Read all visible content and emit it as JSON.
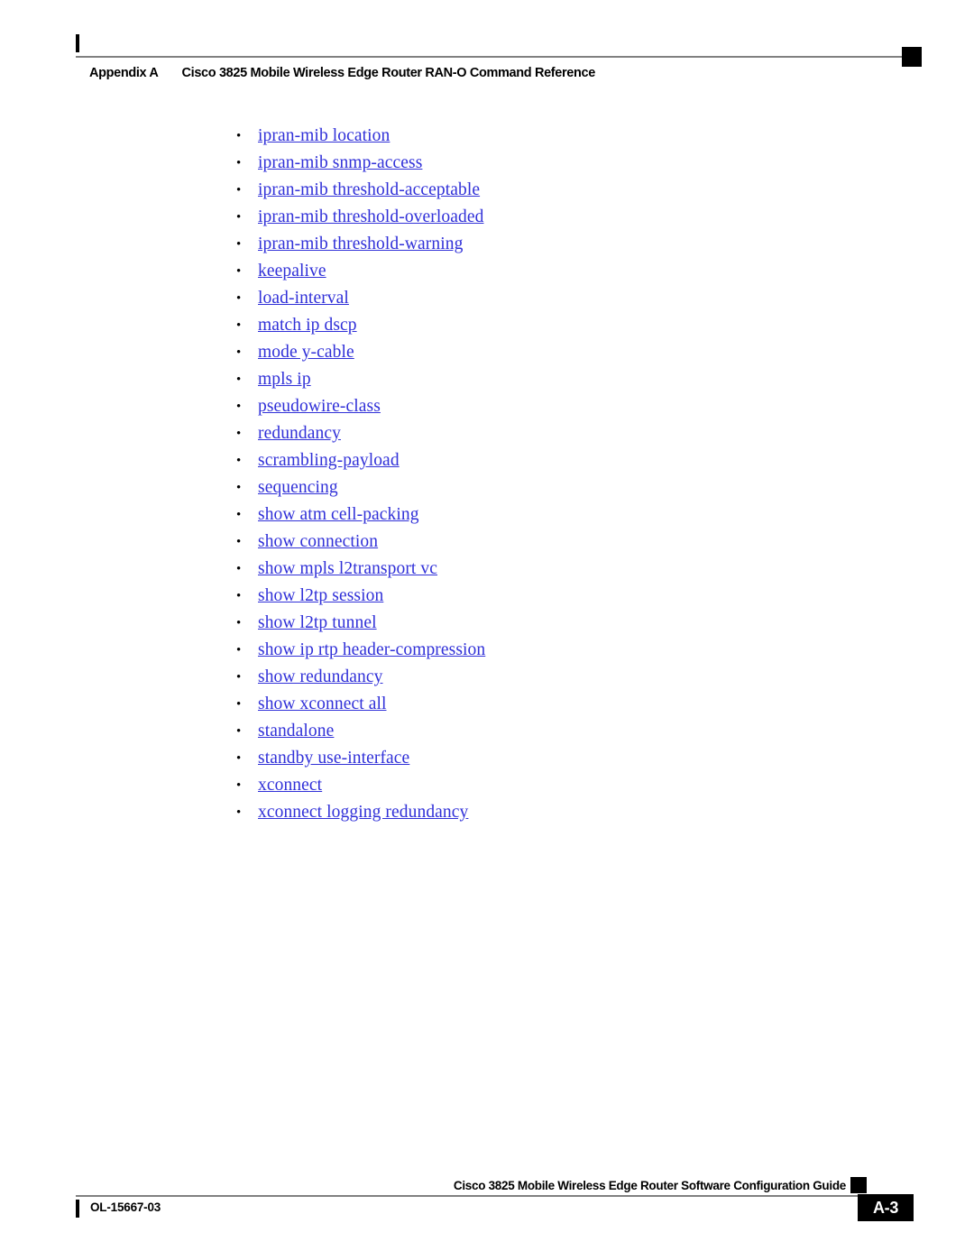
{
  "header": {
    "left_marker": "vertical-bar",
    "appendix_label": "Appendix A",
    "title": "Cisco 3825 Mobile Wireless Edge Router RAN-O Command Reference"
  },
  "main": {
    "bullet_glyph": "•",
    "link_color": "#3030D8",
    "commands": [
      {
        "label": "ipran-mib location"
      },
      {
        "label": "ipran-mib snmp-access"
      },
      {
        "label": "ipran-mib threshold-acceptable"
      },
      {
        "label": "ipran-mib threshold-overloaded"
      },
      {
        "label": "ipran-mib threshold-warning"
      },
      {
        "label": "keepalive"
      },
      {
        "label": "load-interval"
      },
      {
        "label": "match ip dscp"
      },
      {
        "label": "mode y-cable"
      },
      {
        "label": "mpls ip"
      },
      {
        "label": "pseudowire-class"
      },
      {
        "label": "redundancy"
      },
      {
        "label": "scrambling-payload"
      },
      {
        "label": "sequencing"
      },
      {
        "label": "show atm cell-packing"
      },
      {
        "label": "show connection"
      },
      {
        "label": "show mpls l2transport vc"
      },
      {
        "label": "show l2tp session"
      },
      {
        "label": "show l2tp tunnel"
      },
      {
        "label": "show ip rtp header-compression"
      },
      {
        "label": "show redundancy"
      },
      {
        "label": "show xconnect all"
      },
      {
        "label": "standalone"
      },
      {
        "label": "standby use-interface"
      },
      {
        "label": "xconnect"
      },
      {
        "label": "xconnect logging redundancy"
      }
    ]
  },
  "footer": {
    "guide_title": "Cisco 3825 Mobile Wireless Edge Router Software Configuration Guide",
    "doc_id": "OL-15667-03",
    "page_number": "A-3"
  }
}
